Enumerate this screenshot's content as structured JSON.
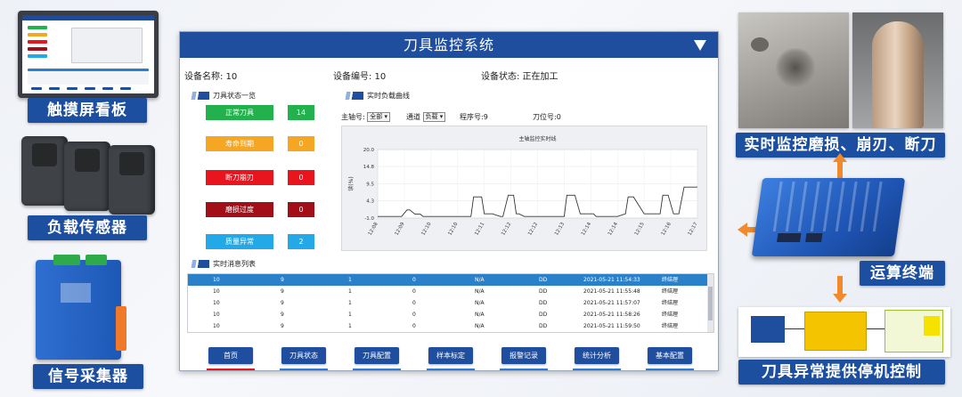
{
  "labels": {
    "touchscreen": "触摸屏看板",
    "load_sensor": "负载传感器",
    "signal_collector": "信号采集器",
    "realtime_monitor": "实时监控磨损、崩刃、断刀",
    "compute_terminal": "运算终端",
    "stop_control": "刀具异常提供停机控制"
  },
  "window": {
    "title": "刀具监控系统",
    "device_name": "设备名称: 10",
    "device_id": "设备编号: 10",
    "device_status": "设备状态: 正在加工"
  },
  "tool_status": {
    "heading": "刀具状态一览",
    "items": [
      {
        "label": "正常刀具",
        "count": "14",
        "color": "#22b14c",
        "count_color": "#22b14c"
      },
      {
        "label": "寿命到期",
        "count": "0",
        "color": "#f5a623",
        "count_color": "#f5a623"
      },
      {
        "label": "断刀崩刃",
        "count": "0",
        "color": "#e8141e",
        "count_color": "#e8141e"
      },
      {
        "label": "磨损过度",
        "count": "0",
        "color": "#a30f18",
        "count_color": "#a30f18"
      },
      {
        "label": "质量异常",
        "count": "2",
        "color": "#23a8e8",
        "count_color": "#23a8e8"
      }
    ]
  },
  "load_curve": {
    "heading": "实时负载曲线",
    "spindle_label": "主轴号:",
    "spindle_value": "全部",
    "channel_label": "通道",
    "channel_value": "负载",
    "program_label": "程序号:9",
    "tool_pos_label": "刀位号:0"
  },
  "chart_data": {
    "type": "line",
    "title": "主轴监控实时线",
    "ylabel": "读(%)",
    "ylim": [
      -1.0,
      20.0
    ],
    "yticks": [
      "20.0",
      "14.8",
      "9.5",
      "4.3",
      "-1.0"
    ],
    "x": [
      "12:08",
      "12:09",
      "12:10",
      "12:10",
      "12:11",
      "12:12",
      "12:12",
      "12:13",
      "12:14",
      "12:14",
      "12:15",
      "12:16",
      "12:17"
    ],
    "series": [
      {
        "values_x": [
          0,
          0.7,
          0.9,
          1.1,
          1.2,
          1.4,
          1.6,
          1.7,
          1.9,
          2.4,
          3.5,
          3.6,
          3.7,
          3.9,
          4.0,
          4.3,
          4.6,
          4.7,
          4.9,
          5.1,
          5.2,
          5.3,
          5.5,
          6.0,
          7.0,
          7.1,
          7.2,
          7.4,
          7.6,
          8.1,
          8.2,
          8.4,
          9.0,
          9.3,
          9.4,
          9.6,
          10.0,
          10.6,
          10.7,
          10.9,
          11.1,
          11.2,
          11.3,
          11.5,
          11.7,
          11.8,
          12.0
        ],
        "values_y": [
          -0.5,
          -0.5,
          -0.5,
          1.5,
          1.5,
          0.2,
          0.2,
          -0.5,
          -0.5,
          -0.5,
          -0.5,
          5.5,
          5.5,
          5.5,
          0.3,
          0.3,
          -0.5,
          -0.5,
          6.0,
          6.0,
          0.3,
          0.3,
          -0.5,
          -0.5,
          -0.5,
          6.0,
          6.0,
          6.0,
          0.3,
          0.3,
          -0.5,
          -0.5,
          -0.5,
          0.3,
          5.5,
          5.5,
          0.3,
          0.3,
          6.0,
          6.0,
          0.3,
          0.3,
          0.3,
          8.5,
          8.5,
          8.5,
          8.5
        ],
        "color": "#333333"
      }
    ],
    "grid": true
  },
  "messages": {
    "heading": "实时消息列表",
    "rows": [
      [
        "10",
        "9",
        "1",
        "0",
        "N/A",
        "DD",
        "2021-05-21 11:54:33",
        "终结理"
      ],
      [
        "10",
        "9",
        "1",
        "0",
        "N/A",
        "DD",
        "2021-05-21 11:55:48",
        "终结理"
      ],
      [
        "10",
        "9",
        "1",
        "0",
        "N/A",
        "DD",
        "2021-05-21 11:57:07",
        "终结理"
      ],
      [
        "10",
        "9",
        "1",
        "0",
        "N/A",
        "DD",
        "2021-05-21 11:58:26",
        "终结理"
      ],
      [
        "10",
        "9",
        "1",
        "0",
        "N/A",
        "DD",
        "2021-05-21 11:59:50",
        "终结理"
      ]
    ]
  },
  "nav": [
    {
      "label": "首页",
      "active": true
    },
    {
      "label": "刀具状态"
    },
    {
      "label": "刀具配置"
    },
    {
      "label": "样本标定"
    },
    {
      "label": "报警记录"
    },
    {
      "label": "统计分析"
    },
    {
      "label": "基本配置"
    }
  ],
  "colors": {
    "brand_blue": "#1f4e9f",
    "label_blue": "#1c4fa0",
    "arrow_orange": "#f08a2c",
    "row_highlight": "#2a80c9"
  }
}
